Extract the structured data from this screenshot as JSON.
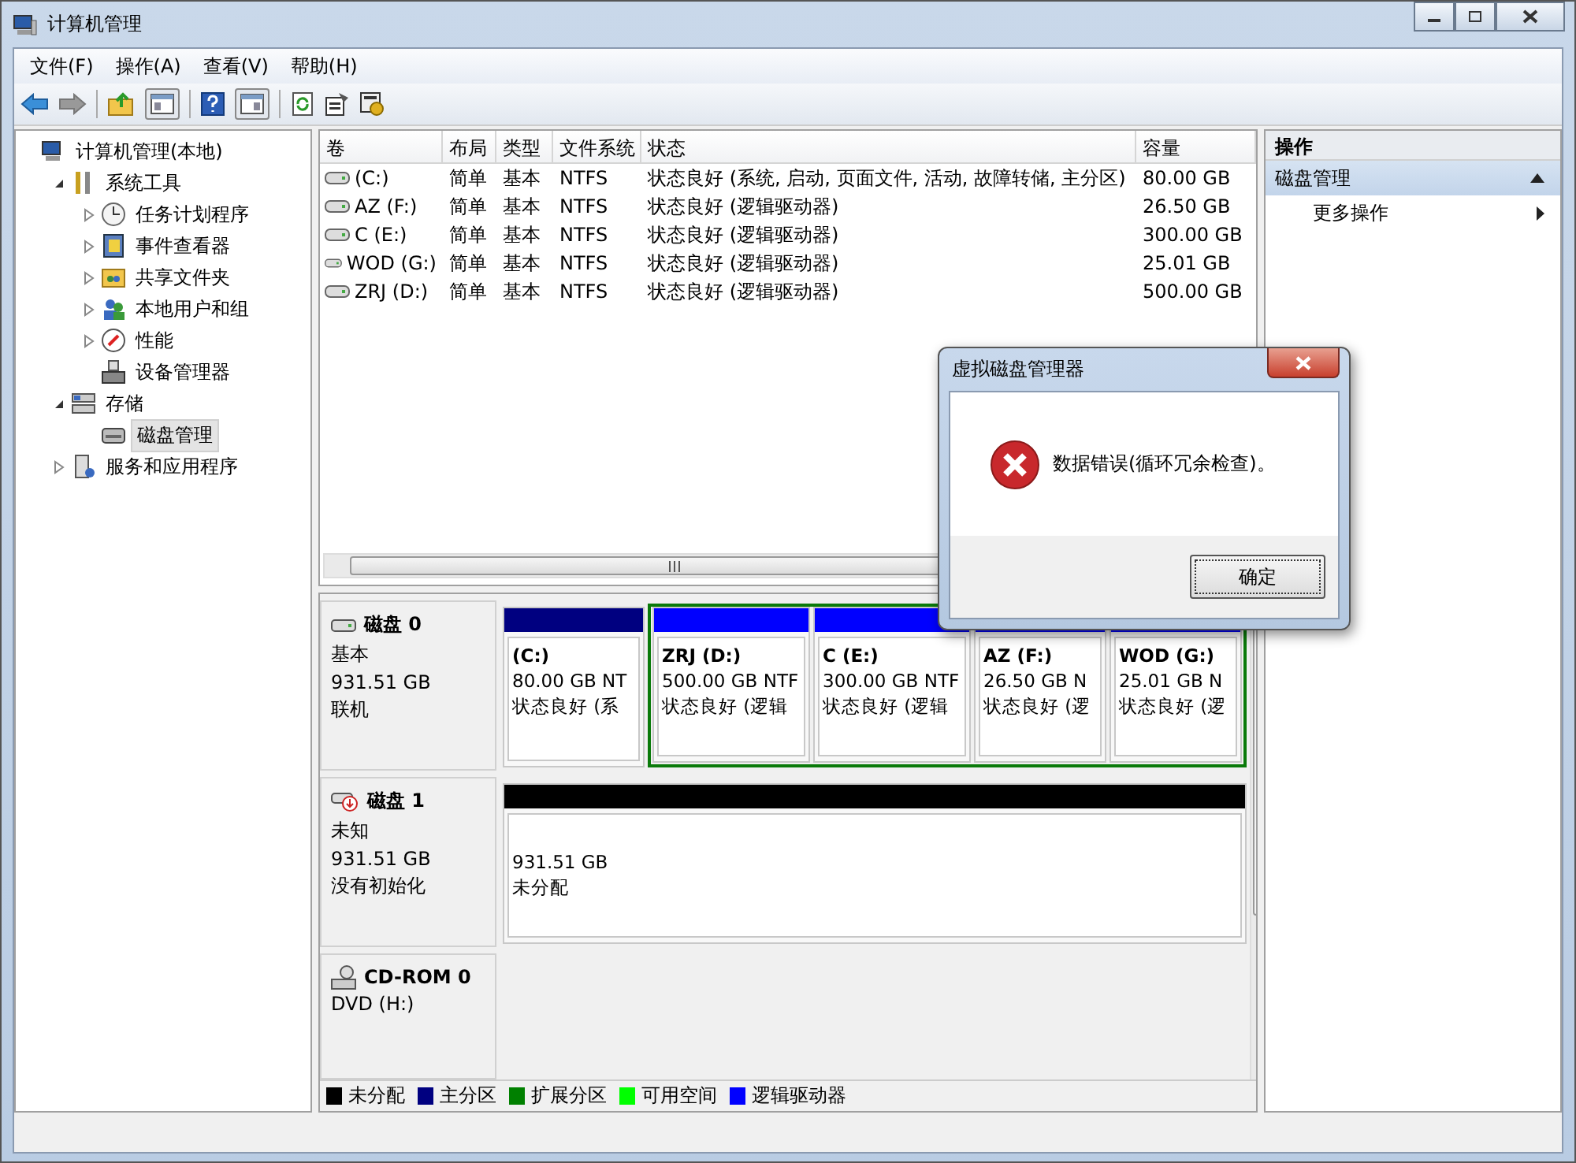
{
  "window": {
    "title": "计算机管理"
  },
  "menu": [
    "文件(F)",
    "操作(A)",
    "查看(V)",
    "帮助(H)"
  ],
  "tree": {
    "items": [
      {
        "label": "计算机管理(本地)",
        "selected": false,
        "children": [
          {
            "label": "系统工具",
            "selected": false,
            "expanded": true,
            "children": [
              {
                "label": "任务计划程序",
                "selected": false,
                "expanded": false
              },
              {
                "label": "事件查看器",
                "selected": false,
                "expanded": false
              },
              {
                "label": "共享文件夹",
                "selected": false,
                "expanded": false
              },
              {
                "label": "本地用户和组",
                "selected": false,
                "expanded": false
              },
              {
                "label": "性能",
                "selected": false,
                "expanded": false
              },
              {
                "label": "设备管理器",
                "selected": false
              }
            ]
          },
          {
            "label": "存储",
            "selected": false,
            "expanded": true,
            "children": [
              {
                "label": "磁盘管理",
                "selected": true
              }
            ]
          },
          {
            "label": "服务和应用程序",
            "selected": false,
            "expanded": false
          }
        ]
      }
    ]
  },
  "table": {
    "columns": [
      "卷",
      "布局",
      "类型",
      "文件系统",
      "状态",
      "容量"
    ],
    "rows": [
      [
        "(C:)",
        "简单",
        "基本",
        "NTFS",
        "状态良好 (系统, 启动, 页面文件, 活动, 故障转储, 主分区)",
        "80.00 GB"
      ],
      [
        "AZ (F:)",
        "简单",
        "基本",
        "NTFS",
        "状态良好 (逻辑驱动器)",
        "26.50 GB"
      ],
      [
        "C (E:)",
        "简单",
        "基本",
        "NTFS",
        "状态良好 (逻辑驱动器)",
        "300.00 GB"
      ],
      [
        "WOD (G:)",
        "简单",
        "基本",
        "NTFS",
        "状态良好 (逻辑驱动器)",
        "25.01 GB"
      ],
      [
        "ZRJ (D:)",
        "简单",
        "基本",
        "NTFS",
        "状态良好 (逻辑驱动器)",
        "500.00 GB"
      ]
    ]
  },
  "disks": [
    {
      "kind": "disk",
      "name": "磁盘 0",
      "lines": [
        "基本",
        "931.51 GB",
        "联机"
      ],
      "partitions": [
        {
          "kind": "primary",
          "name": "(C:)",
          "size": "80.00 GB NT",
          "status": "状态良好 (系"
        },
        {
          "kind": "extended",
          "partitions": [
            {
              "kind": "logical",
              "name": "ZRJ  (D:)",
              "size": "500.00 GB NTF",
              "status": "状态良好 (逻辑"
            },
            {
              "kind": "logical",
              "name": "C  (E:)",
              "size": "300.00 GB NTF",
              "status": "状态良好 (逻辑"
            },
            {
              "kind": "logical",
              "name": "AZ  (F:)",
              "size": "26.50 GB N",
              "status": "状态良好 (逻"
            },
            {
              "kind": "logical",
              "name": "WOD  (G:)",
              "size": "25.01 GB N",
              "status": "状态良好 (逻"
            }
          ]
        }
      ]
    },
    {
      "kind": "unknown",
      "name": "磁盘 1",
      "lines": [
        "未知",
        "931.51 GB",
        "没有初始化"
      ],
      "partitions": [
        {
          "kind": "unallocated",
          "size": "931.51 GB",
          "status": "未分配"
        }
      ]
    },
    {
      "kind": "cdrom",
      "name": "CD-ROM 0",
      "lines": [
        "DVD (H:)"
      ]
    }
  ],
  "legend": [
    {
      "label": "未分配",
      "color": "#000000"
    },
    {
      "label": "主分区",
      "color": "#000080"
    },
    {
      "label": "扩展分区",
      "color": "#008000"
    },
    {
      "label": "可用空间",
      "color": "#00ff00"
    },
    {
      "label": "逻辑驱动器",
      "color": "#0000ff"
    }
  ],
  "actions": {
    "header": "操作",
    "section": "磁盘管理",
    "items": [
      "更多操作"
    ]
  },
  "dialog": {
    "title": "虚拟磁盘管理器",
    "message": "数据错误(循环冗余检查)。",
    "button": "确定"
  }
}
